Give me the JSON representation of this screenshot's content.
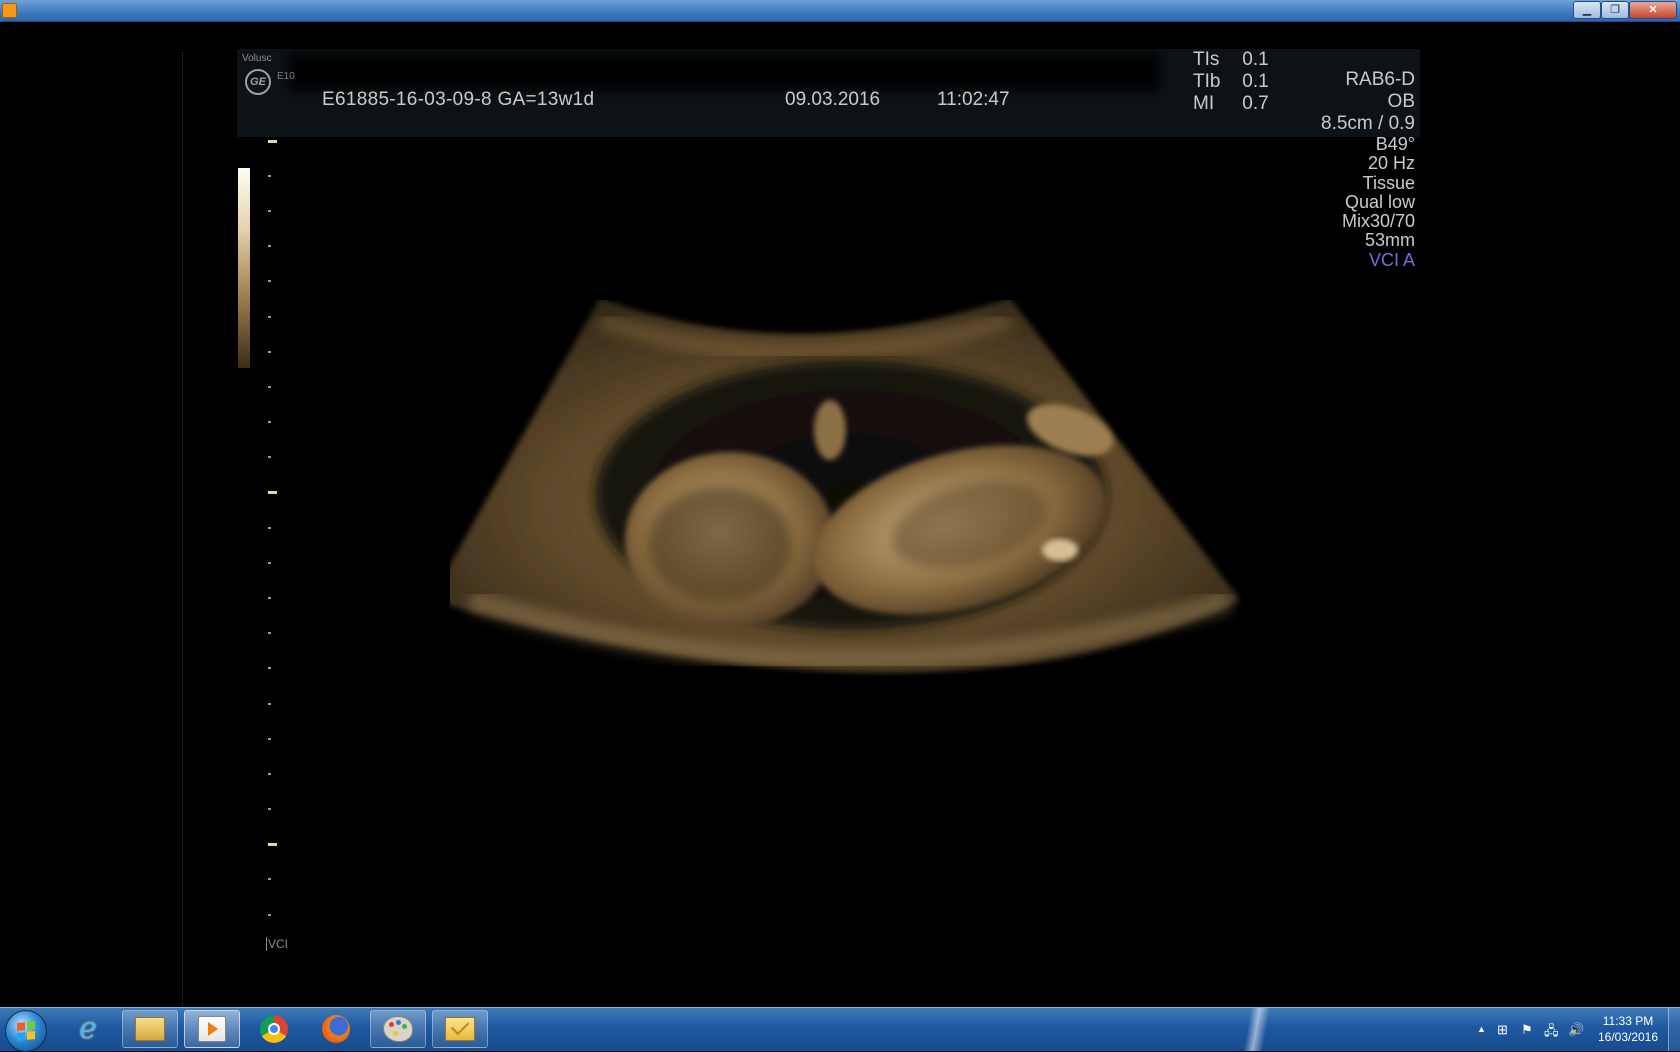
{
  "window": {
    "title": "",
    "minimize_glyph": "▁",
    "maximize_glyph": "❐",
    "close_glyph": "✕"
  },
  "header": {
    "logo_small_text": "Volusc",
    "ge_logo_text": "GE",
    "logo_model_text": "E10",
    "patient_id": "E61885-16-03-09-8  GA=13w1d",
    "date": "09.03.2016",
    "time": "11:02:47",
    "indices": [
      {
        "label": "TIs",
        "value": "0.1"
      },
      {
        "label": "TIb",
        "value": "0.1"
      },
      {
        "label": "MI",
        "value": "0.7"
      }
    ]
  },
  "params": {
    "probe": "RAB6-D",
    "preset": "OB",
    "depth": "8.5cm / 0.9",
    "angle": "B49°",
    "frame_rate": "20 Hz",
    "tissue": "Tissue",
    "quality": "Qual low",
    "mix": "Mix30/70",
    "slice": "53mm",
    "vci": "VCI A"
  },
  "ruler": {
    "label": "VCI"
  },
  "taskbar": {
    "apps": [
      {
        "name": "internet-explorer-icon",
        "state": "pinned"
      },
      {
        "name": "windows-explorer-icon",
        "state": "pinned"
      },
      {
        "name": "media-player-icon",
        "state": "active"
      },
      {
        "name": "chrome-icon",
        "state": "pinned"
      },
      {
        "name": "firefox-icon",
        "state": "pinned"
      },
      {
        "name": "paint-icon",
        "state": "pinned"
      },
      {
        "name": "outlook-icon",
        "state": "pinned"
      }
    ],
    "tray": {
      "show_hidden": "▲",
      "time": "11:33 PM",
      "date": "16/03/2016"
    }
  }
}
